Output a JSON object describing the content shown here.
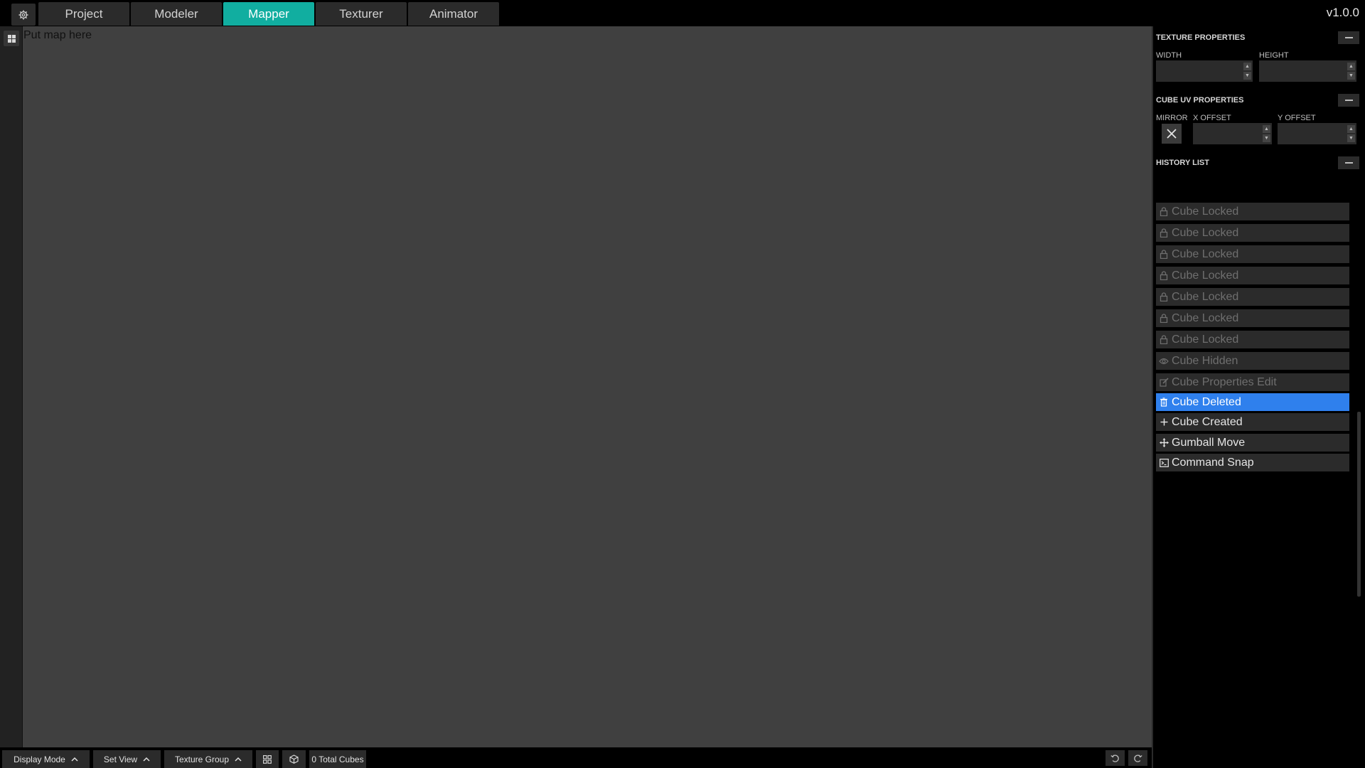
{
  "header": {
    "tabs": [
      {
        "label": "Project",
        "active": false
      },
      {
        "label": "Modeler",
        "active": false
      },
      {
        "label": "Mapper",
        "active": true
      },
      {
        "label": "Texturer",
        "active": false
      },
      {
        "label": "Animator",
        "active": false
      }
    ],
    "version": "v1.0.0",
    "settings_icon": "gear-icon"
  },
  "canvas": {
    "placeholder": "Put map here"
  },
  "texture_properties": {
    "title": "TEXTURE PROPERTIES",
    "width_label": "WIDTH",
    "height_label": "HEIGHT",
    "width_value": "",
    "height_value": ""
  },
  "cube_uv_properties": {
    "title": "CUBE UV PROPERTIES",
    "mirror_label": "MIRROR",
    "x_offset_label": "X OFFSET",
    "y_offset_label": "Y OFFSET",
    "x_offset_value": "",
    "y_offset_value": ""
  },
  "history": {
    "title": "HISTORY LIST",
    "items": [
      {
        "label": "Cube Locked",
        "icon": "lock-icon",
        "state": "dim"
      },
      {
        "label": "Cube Locked",
        "icon": "lock-icon",
        "state": "dim"
      },
      {
        "label": "Cube Locked",
        "icon": "lock-icon",
        "state": "dim"
      },
      {
        "label": "Cube Locked",
        "icon": "lock-icon",
        "state": "dim"
      },
      {
        "label": "Cube Locked",
        "icon": "lock-icon",
        "state": "dim"
      },
      {
        "label": "Cube Locked",
        "icon": "lock-icon",
        "state": "dim"
      },
      {
        "label": "Cube Locked",
        "icon": "lock-icon",
        "state": "dim"
      },
      {
        "label": "Cube Hidden",
        "icon": "eye-icon",
        "state": "dim"
      },
      {
        "label": "Cube Properties Edit",
        "icon": "edit-icon",
        "state": "dim"
      },
      {
        "label": "Cube Deleted",
        "icon": "trash-icon",
        "state": "selected"
      },
      {
        "label": "Cube Created",
        "icon": "plus-icon",
        "state": "bright"
      },
      {
        "label": "Gumball Move",
        "icon": "move-icon",
        "state": "bright"
      },
      {
        "label": "Command Snap",
        "icon": "terminal-icon",
        "state": "bright"
      }
    ]
  },
  "bottombar": {
    "display_mode": "Display Mode",
    "set_view": "Set View",
    "texture_group": "Texture Group",
    "total_cubes": "0 Total Cubes"
  },
  "colors": {
    "accent": "#11aea0",
    "selected": "#2f80ed",
    "canvas": "#404040",
    "panel": "#2b2b2b"
  }
}
